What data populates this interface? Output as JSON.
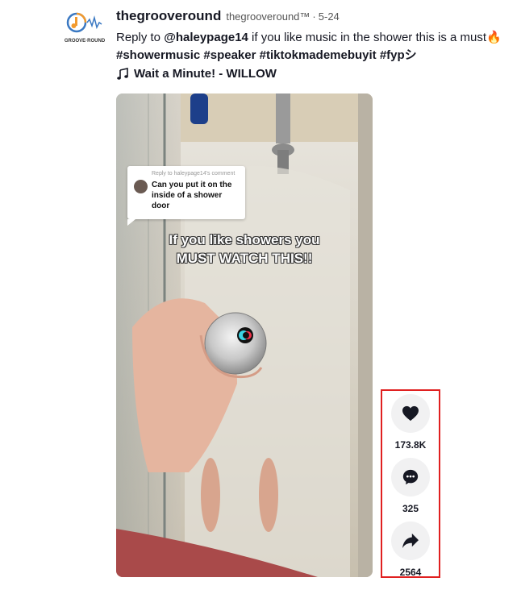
{
  "post": {
    "username": "thegrooveround",
    "nickname": "thegrooveround™",
    "separator": "·",
    "date": "5-24",
    "avatar_label": "GROOVE·ROUND",
    "description": {
      "prefix": "Reply to ",
      "mention": "@haleypage14",
      "text": " if you like music in the shower this is a must",
      "emoji": "🔥",
      "hashtags": [
        "#showermusic",
        "#speaker",
        "#tiktokmademebuyit",
        "#fypシ"
      ]
    },
    "music": {
      "icon": "music-note-icon",
      "title": "Wait a Minute! - WILLOW"
    }
  },
  "video": {
    "comment_header": "Reply to haleypage14's comment",
    "comment_text": "Can you put it on the inside of a shower door",
    "overlay_line1": "If you like showers you",
    "overlay_line2": "MUST WATCH THIS!!"
  },
  "actions": {
    "like": {
      "icon": "heart-icon",
      "count": "173.8K"
    },
    "comment": {
      "icon": "comment-icon",
      "count": "325"
    },
    "share": {
      "icon": "share-icon",
      "count": "2564"
    }
  },
  "colors": {
    "highlight_border": "#e02020",
    "action_circle": "#f1f1f2"
  }
}
